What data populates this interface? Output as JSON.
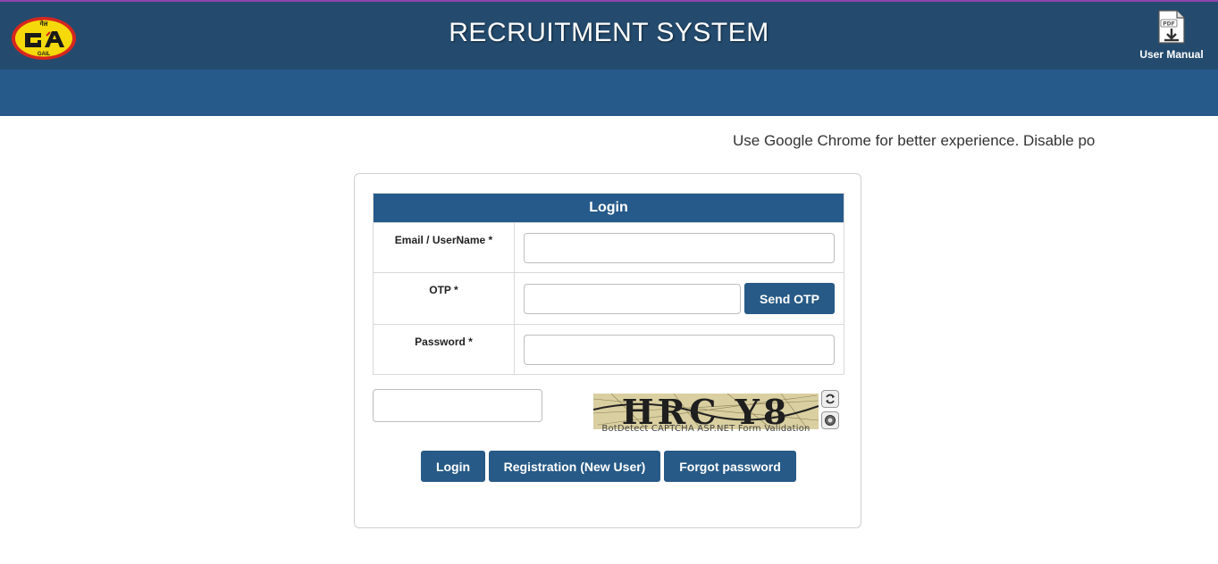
{
  "header": {
    "logo_text": "GAIL",
    "logo_hindi": "गेल",
    "title": "RECRUITMENT SYSTEM",
    "manual_badge": "PDF",
    "manual_label": "User Manual"
  },
  "notice": "Use Google Chrome for better experience. Disable po",
  "login": {
    "heading": "Login",
    "email_label": "Email / UserName *",
    "email_value": "",
    "otp_label": "OTP *",
    "otp_value": "",
    "send_otp_label": "Send OTP",
    "password_label": "Password *",
    "password_value": "",
    "captcha_value": "",
    "captcha_text": "HRC Y8",
    "captcha_caption": "BotDetect CAPTCHA ASP.NET Form Validation",
    "buttons": {
      "login": "Login",
      "register": "Registration (New User)",
      "forgot": "Forgot password"
    }
  },
  "colors": {
    "header_bg": "#244b6e",
    "subbar_bg": "#265a8a",
    "button_bg": "#275a86",
    "logo_yellow": "#f5d90a",
    "logo_red": "#d7261e"
  },
  "icons": [
    "gail-logo",
    "pdf-download-icon",
    "captcha-reload-icon",
    "captcha-audio-icon"
  ]
}
